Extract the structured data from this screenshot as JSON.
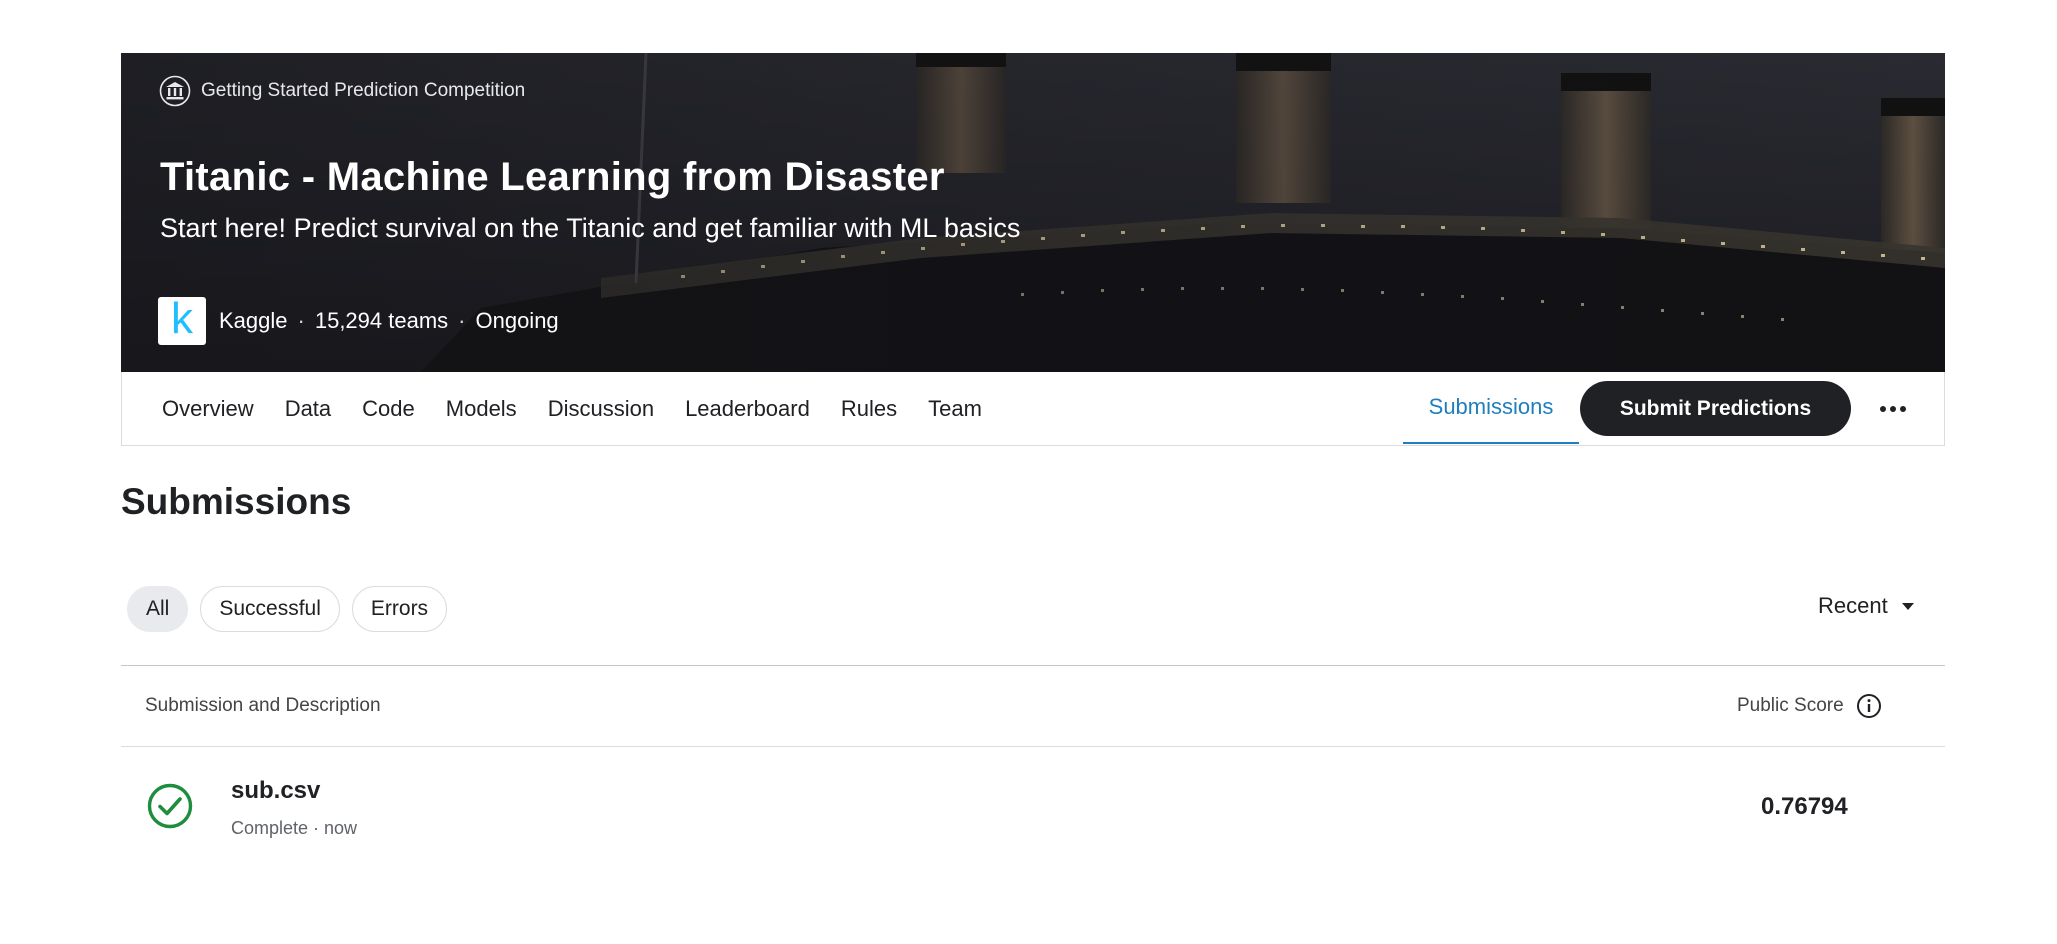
{
  "hero": {
    "category": "Getting Started Prediction Competition",
    "title": "Titanic - Machine Learning from Disaster",
    "subtitle": "Start here! Predict survival on the Titanic and get familiar with ML basics",
    "host_logo_letter": "k",
    "host": "Kaggle",
    "teams": "15,294 teams",
    "status": "Ongoing",
    "separator": "·"
  },
  "tabs": {
    "items": [
      {
        "label": "Overview"
      },
      {
        "label": "Data"
      },
      {
        "label": "Code"
      },
      {
        "label": "Models"
      },
      {
        "label": "Discussion"
      },
      {
        "label": "Leaderboard"
      },
      {
        "label": "Rules"
      },
      {
        "label": "Team"
      }
    ],
    "active": "Submissions",
    "submit_label": "Submit Predictions"
  },
  "page": {
    "heading": "Submissions"
  },
  "filters": {
    "chips": [
      {
        "label": "All",
        "active": true
      },
      {
        "label": "Successful",
        "active": false
      },
      {
        "label": "Errors",
        "active": false
      }
    ],
    "sort": "Recent"
  },
  "table": {
    "col_desc": "Submission and Description",
    "col_score": "Public Score",
    "rows": [
      {
        "file": "sub.csv",
        "meta": "Complete · now",
        "score": "0.76794",
        "status": "success"
      }
    ]
  },
  "colors": {
    "accent": "#1f7fbe",
    "success": "#1e8e3e",
    "kaggle_blue": "#20beff",
    "primary_button": "#202124"
  },
  "icons": {
    "category": "institution-icon",
    "more": "more-horizontal-icon",
    "sort": "caret-down-icon",
    "info": "info-icon",
    "status": "check-circle-icon"
  }
}
